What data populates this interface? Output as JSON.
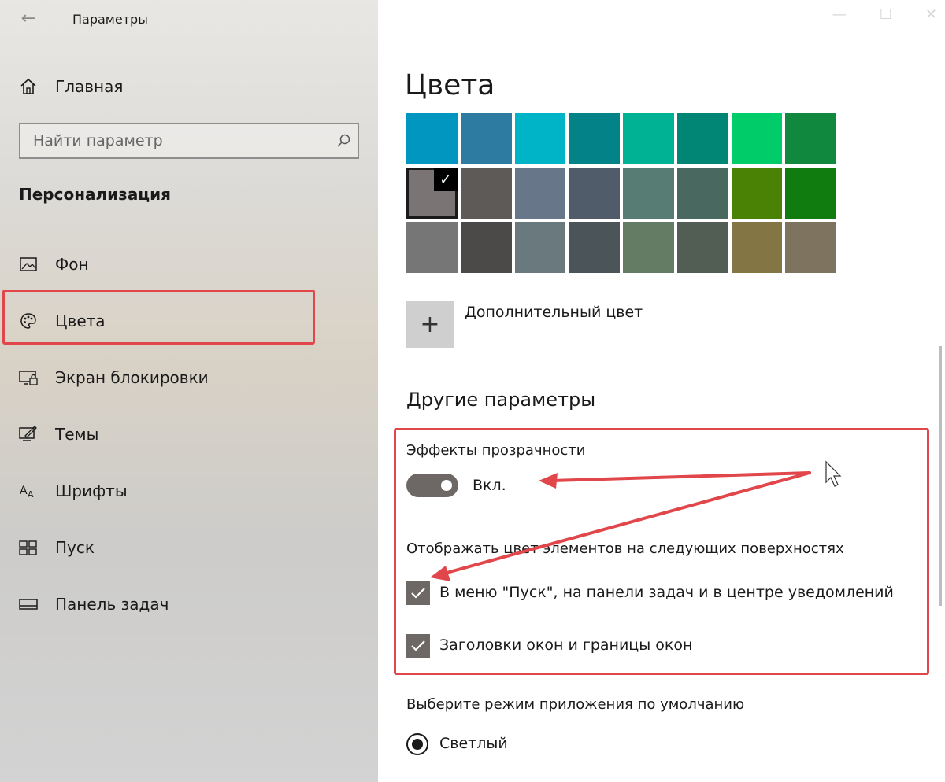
{
  "window": {
    "title": "Параметры",
    "back_icon": "back-arrow-icon"
  },
  "sidebar": {
    "home_label": "Главная",
    "search_placeholder": "Найти параметр",
    "section_title": "Персонализация",
    "items": [
      {
        "label": "Фон",
        "icon": "image-icon"
      },
      {
        "label": "Цвета",
        "icon": "palette-icon"
      },
      {
        "label": "Экран блокировки",
        "icon": "lock-screen-icon"
      },
      {
        "label": "Темы",
        "icon": "themes-icon"
      },
      {
        "label": "Шрифты",
        "icon": "fonts-icon"
      },
      {
        "label": "Пуск",
        "icon": "start-icon"
      },
      {
        "label": "Панель задач",
        "icon": "taskbar-icon"
      }
    ],
    "active_item": "Цвета"
  },
  "main": {
    "title": "Цвета",
    "swatches": [
      [
        "#0096bf",
        "#2d7ba0",
        "#00b4c8",
        "#038387",
        "#00b294",
        "#018574",
        "#00cc6a",
        "#10893e"
      ],
      [
        "#7a7574",
        "#5d5a58",
        "#68768a",
        "#515c6b",
        "#567c73",
        "#486860",
        "#498205",
        "#107c10"
      ],
      [
        "#767676",
        "#4c4a48",
        "#69797e",
        "#4a5459",
        "#647c64",
        "#525e54",
        "#847545",
        "#7e735f"
      ]
    ],
    "selected_swatch": "#7a7574",
    "custom_color_label": "Дополнительный цвет",
    "other_params_heading": "Другие параметры",
    "transparency_label": "Эффекты прозрачности",
    "transparency_state": "Вкл.",
    "surfaces_label": "Отображать цвет элементов на следующих поверхностях",
    "checkbox_start": "В меню \"Пуск\", на панели задач и в центре уведомлений",
    "checkbox_titlebars": "Заголовки окон и границы окон",
    "app_mode_label": "Выберите режим приложения по умолчанию",
    "app_mode_option": "Светлый"
  },
  "colors": {
    "accent_gray": "#6d6865",
    "annotation_red": "#e0464a"
  }
}
